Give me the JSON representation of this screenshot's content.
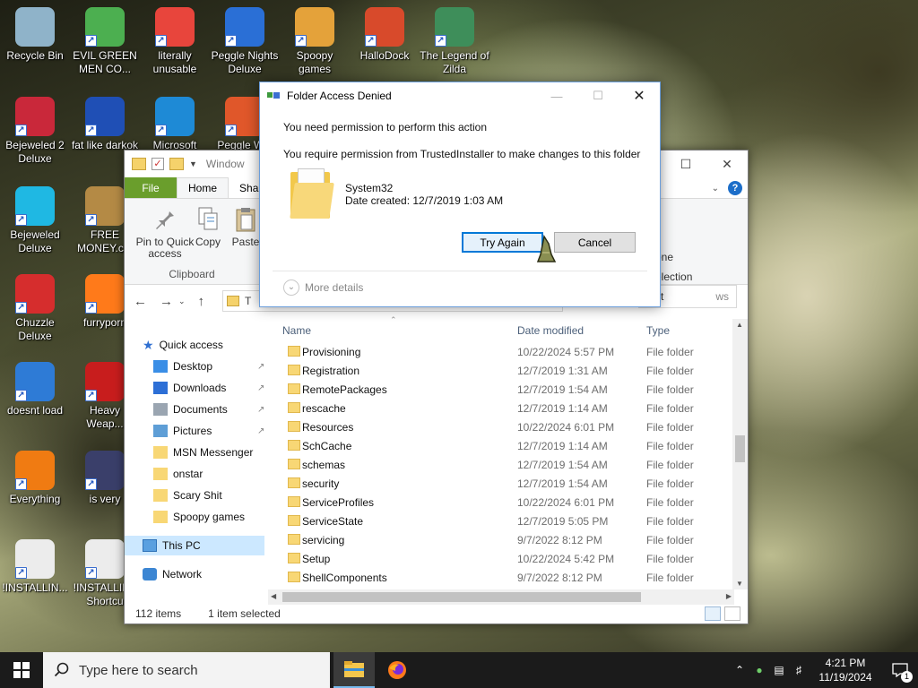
{
  "desktop": {
    "icons": [
      {
        "label": "Recycle Bin",
        "icon": "recycle-bin-icon",
        "color": "#8fb3c9"
      },
      {
        "label": "EVIL GREEN MEN CO...",
        "icon": "green-men-icon",
        "color": "#4caf50"
      },
      {
        "label": "literally unusable",
        "icon": "chrome-icon",
        "color": "#e8453c"
      },
      {
        "label": "Peggle Nights Deluxe",
        "icon": "peggle-nights-icon",
        "color": "#2a6fd6"
      },
      {
        "label": "Spoopy games",
        "icon": "folder-icon",
        "color": "#e4a23a"
      },
      {
        "label": "HalloDock",
        "icon": "windows-shield-icon",
        "color": "#d84a2b"
      },
      {
        "label": "The Legend of Zilda",
        "icon": "zilda-icon",
        "color": "#3e8e5a"
      },
      {
        "label": "Bejeweled 2 Deluxe",
        "icon": "bejeweled-2-icon",
        "color": "#c9283a"
      },
      {
        "label": "fat like darkok",
        "icon": "mpl-icon",
        "color": "#1f4fb5"
      },
      {
        "label": "Microsoft",
        "icon": "edge-icon",
        "color": "#1e8ad6"
      },
      {
        "label": "Peggle W...",
        "icon": "peggle-icon",
        "color": "#e0572a"
      },
      {
        "label": "Bejeweled Deluxe",
        "icon": "bejeweled-icon",
        "color": "#1fb8e3"
      },
      {
        "label": "FREE MONEY.c...",
        "icon": "money-bag-icon",
        "color": "#b48a45"
      },
      {
        "label": "Chuzzle Deluxe",
        "icon": "chuzzle-icon",
        "color": "#d62d2d"
      },
      {
        "label": "furryporn",
        "icon": "firefox-icon",
        "color": "#ff7a1a"
      },
      {
        "label": "doesnt load",
        "icon": "thunderbird-icon",
        "color": "#2e7bd6"
      },
      {
        "label": "Heavy Weap...",
        "icon": "radiation-icon",
        "color": "#c81d1d"
      },
      {
        "label": "Everything",
        "icon": "everything-search-icon",
        "color": "#f07b12"
      },
      {
        "label": "is very",
        "icon": "shield-logo-icon",
        "color": "#3a3f6a"
      },
      {
        "label": "!INSTALLIN...",
        "icon": "text-file-icon",
        "color": "#ececec"
      },
      {
        "label": "!INSTALLIN - Shortcu",
        "icon": "text-file-shortcut-icon",
        "color": "#ececec"
      }
    ]
  },
  "explorer": {
    "title": "Window",
    "tabs": {
      "file": "File",
      "home": "Home",
      "share": "Shar"
    },
    "ribbon": {
      "pin_label": "Pin to Quick access",
      "copy_label": "Copy",
      "paste_label": "Paste",
      "group_label": "Clipboard",
      "right_texts": [
        "ll",
        "one",
        "election",
        "ct"
      ]
    },
    "search_placeholder": "ws",
    "address_text": "T",
    "nav": {
      "quick_access": "Quick access",
      "items": [
        {
          "label": "Desktop",
          "pinned": true
        },
        {
          "label": "Downloads",
          "pinned": true
        },
        {
          "label": "Documents",
          "pinned": true
        },
        {
          "label": "Pictures",
          "pinned": true
        },
        {
          "label": "MSN Messenger",
          "pinned": false
        },
        {
          "label": "onstar",
          "pinned": false
        },
        {
          "label": "Scary Shit",
          "pinned": false
        },
        {
          "label": "Spoopy games",
          "pinned": false
        }
      ],
      "this_pc": "This PC",
      "network": "Network"
    },
    "columns": {
      "name": "Name",
      "date": "Date modified",
      "type": "Type"
    },
    "rows": [
      {
        "name": "Provisioning",
        "date": "10/22/2024 5:57 PM",
        "type": "File folder"
      },
      {
        "name": "Registration",
        "date": "12/7/2019 1:31 AM",
        "type": "File folder"
      },
      {
        "name": "RemotePackages",
        "date": "12/7/2019 1:54 AM",
        "type": "File folder"
      },
      {
        "name": "rescache",
        "date": "12/7/2019 1:14 AM",
        "type": "File folder"
      },
      {
        "name": "Resources",
        "date": "10/22/2024 6:01 PM",
        "type": "File folder"
      },
      {
        "name": "SchCache",
        "date": "12/7/2019 1:14 AM",
        "type": "File folder"
      },
      {
        "name": "schemas",
        "date": "12/7/2019 1:54 AM",
        "type": "File folder"
      },
      {
        "name": "security",
        "date": "12/7/2019 1:54 AM",
        "type": "File folder"
      },
      {
        "name": "ServiceProfiles",
        "date": "10/22/2024 6:01 PM",
        "type": "File folder"
      },
      {
        "name": "ServiceState",
        "date": "12/7/2019 5:05 PM",
        "type": "File folder"
      },
      {
        "name": "servicing",
        "date": "9/7/2022 8:12 PM",
        "type": "File folder"
      },
      {
        "name": "Setup",
        "date": "10/22/2024 5:42 PM",
        "type": "File folder"
      },
      {
        "name": "ShellComponents",
        "date": "9/7/2022 8:12 PM",
        "type": "File folder"
      }
    ],
    "status": {
      "count": "112 items",
      "selected": "1 item selected"
    }
  },
  "dialog": {
    "title": "Folder Access Denied",
    "message": "You need permission to perform this action",
    "detail": "You require permission from TrustedInstaller to make changes to this folder",
    "folder_name": "System32",
    "folder_date": "Date created: 12/7/2019 1:03 AM",
    "try_again": "Try Again",
    "cancel": "Cancel",
    "more_details": "More details"
  },
  "taskbar": {
    "search_placeholder": "Type here to search",
    "time": "4:21 PM",
    "date": "11/19/2024",
    "notification_count": "1"
  }
}
